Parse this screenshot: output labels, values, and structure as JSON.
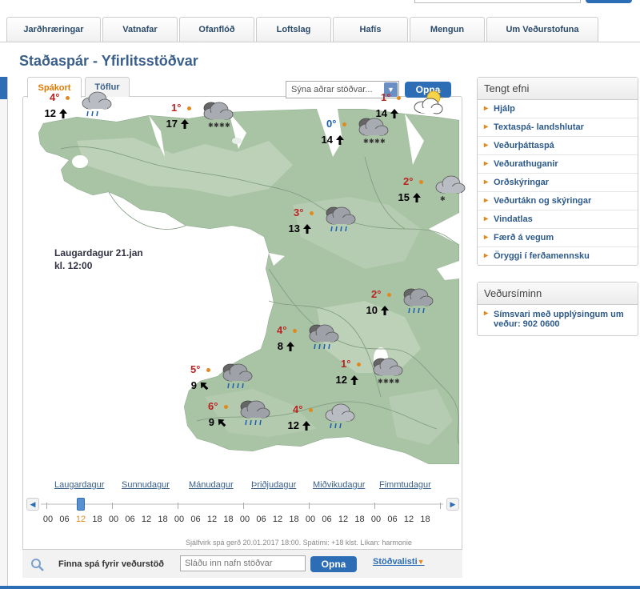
{
  "nav": {
    "tabs": [
      "Jarðhræringar",
      "Vatnafar",
      "Ofanflóð",
      "Loftslag",
      "Hafís",
      "Mengun",
      "Um Veðurstofuna"
    ]
  },
  "page": {
    "title": "Staðaspár - Yfirlitsstöðvar"
  },
  "subtabs": {
    "map": "Spákort",
    "tables": "Töflur"
  },
  "station_select": {
    "label": "Sýna aðrar stöðvar...",
    "open": "Opna"
  },
  "map": {
    "date_line1": "Laugardagur 21.jan",
    "date_line2": "kl. 12:00",
    "stations": [
      {
        "temp": "4°",
        "wind": "12",
        "icon": "rain-cloud-icon"
      },
      {
        "temp": "1°",
        "wind": "17",
        "icon": "snow-cloud-icon"
      },
      {
        "temp": "0°",
        "wind": "14",
        "icon": "snow-cloud-icon"
      },
      {
        "temp": "1°",
        "wind": "14",
        "icon": "partly-sunny-icon"
      },
      {
        "temp": "2°",
        "wind": "15",
        "icon": "sleet-cloud-icon"
      },
      {
        "temp": "3°",
        "wind": "13",
        "icon": "heavy-rain-icon"
      },
      {
        "temp": "2°",
        "wind": "10",
        "icon": "heavy-rain-icon"
      },
      {
        "temp": "4°",
        "wind": "8",
        "icon": "heavy-rain-icon"
      },
      {
        "temp": "5°",
        "wind": "9",
        "icon": "heavy-rain-icon"
      },
      {
        "temp": "1°",
        "wind": "12",
        "icon": "snow-cloud-icon"
      },
      {
        "temp": "6°",
        "wind": "9",
        "icon": "heavy-rain-icon"
      },
      {
        "temp": "4°",
        "wind": "12",
        "icon": "rain-cloud-icon"
      }
    ]
  },
  "timeline": {
    "days": [
      "Laugardagur",
      "Sunnudagur",
      "Mánudagur",
      "Þriðjudagur",
      "Miðvikudagur",
      "Fimmtudagur"
    ],
    "hours": [
      "00",
      "06",
      "12",
      "18",
      "00",
      "06",
      "12",
      "18",
      "00",
      "06",
      "12",
      "18",
      "00",
      "06",
      "12",
      "18",
      "00",
      "06",
      "12",
      "18",
      "00",
      "06",
      "12",
      "18"
    ],
    "selected_index": 2,
    "meta": "Sjálfvirk spá gerð 20.01.2017 18:00. Spátími: +18 klst. Líkan: harmonie"
  },
  "find": {
    "label": "Finna spá fyrir veðurstöð",
    "placeholder": "Sláðu inn nafn stöðvar",
    "open": "Opna",
    "list": "Stöðvalisti"
  },
  "related": {
    "title": "Tengt efni",
    "items": [
      "Hjálp",
      "Textaspá- landshlutar",
      "Veðurþáttaspá",
      "Veðurathuganir",
      "Orðskýringar",
      "Veðurtákn og skýringar",
      "Vindatlas",
      "Færð á vegum",
      "Öryggi í ferðamennsku"
    ]
  },
  "phone": {
    "title": "Veðursíminn",
    "text": "Símsvari með upplýsingum um veður: 902 0600"
  }
}
